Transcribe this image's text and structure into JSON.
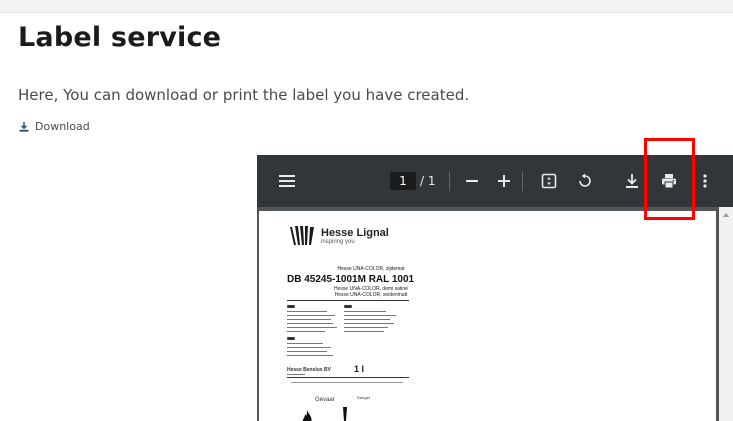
{
  "page": {
    "title": "Label service",
    "subtitle": "Here, You can download or print the label you have created.",
    "download_label": "Download"
  },
  "viewer": {
    "page_current": "1",
    "page_total": "/ 1",
    "icons": [
      "menu-icon",
      "zoom-out-icon",
      "zoom-in-icon",
      "fit-page-icon",
      "rotate-icon",
      "download-icon",
      "print-icon",
      "more-vert-icon"
    ]
  },
  "document": {
    "brand": "Hesse Lignal",
    "brand_tag": "inspiring you",
    "product_line1": "Hesse UNA-COLOR, zijdemat",
    "product_code": "DB 45245-1001M RAL 1001",
    "product_line2": "Hesse UNA-COLOR, demi satiné",
    "product_line3": "Hesse UNA-COLOR, seidenmatt",
    "company": "Hesse Benelux BV",
    "volume": "1 l",
    "hazard_word": "Gevaar",
    "hazard_word_small": "Danger"
  },
  "colors": {
    "highlight": "#ff0000",
    "viewer_toolbar": "#323639",
    "viewer_bg": "#525659"
  }
}
